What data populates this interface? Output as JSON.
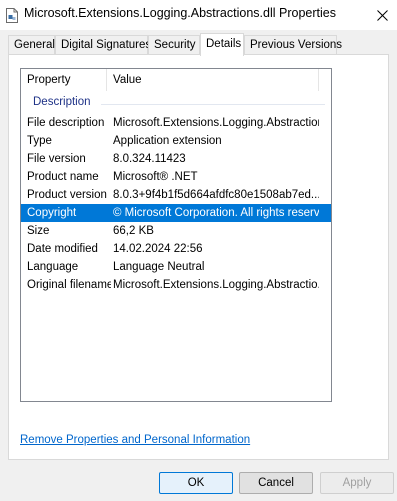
{
  "window": {
    "title": "Microsoft.Extensions.Logging.Abstractions.dll Properties",
    "icon": "document-icon",
    "close_glyph": "✕"
  },
  "tabs": [
    {
      "label": "General",
      "active": false
    },
    {
      "label": "Digital Signatures",
      "active": false
    },
    {
      "label": "Security",
      "active": false
    },
    {
      "label": "Details",
      "active": true
    },
    {
      "label": "Previous Versions",
      "active": false
    }
  ],
  "details": {
    "columns": {
      "property": "Property",
      "value": "Value"
    },
    "group": "Description",
    "rows": [
      {
        "property": "File description",
        "value": "Microsoft.Extensions.Logging.Abstractions"
      },
      {
        "property": "Type",
        "value": "Application extension"
      },
      {
        "property": "File version",
        "value": "8.0.324.11423"
      },
      {
        "property": "Product name",
        "value": "Microsoft® .NET"
      },
      {
        "property": "Product version",
        "value": "8.0.3+9f4b1f5d664afdfc80e1508ab7ed..."
      },
      {
        "property": "Copyright",
        "value": "© Microsoft Corporation. All rights reserv..."
      },
      {
        "property": "Size",
        "value": "66,2 KB"
      },
      {
        "property": "Date modified",
        "value": "14.02.2024 22:56"
      },
      {
        "property": "Language",
        "value": "Language Neutral"
      },
      {
        "property": "Original filename",
        "value": "Microsoft.Extensions.Logging.Abstractio..."
      }
    ],
    "selected_row": "Copyright"
  },
  "link": "Remove Properties and Personal Information",
  "buttons": {
    "ok": "OK",
    "cancel": "Cancel",
    "apply": "Apply"
  },
  "colors": {
    "selection": "#0078d7",
    "link": "#0066cc",
    "group_label": "#1e3287"
  }
}
